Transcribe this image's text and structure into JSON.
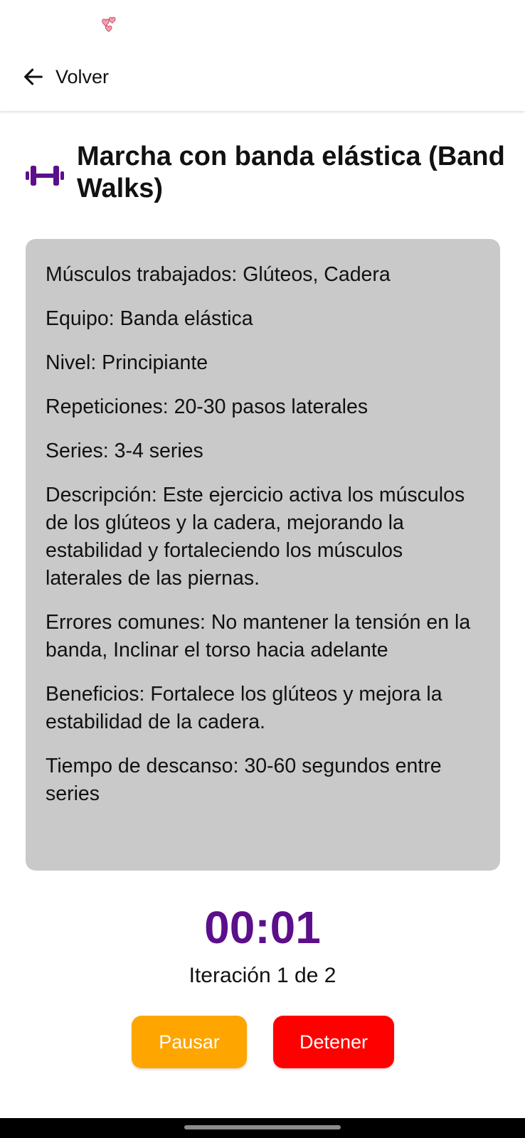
{
  "status_bar": {
    "icon": "hearts-icon"
  },
  "header": {
    "back_label": "Volver",
    "back_icon": "arrow-left-icon"
  },
  "exercise": {
    "icon": "dumbbell-icon",
    "title": "Marcha con banda elástica (Band Walks)",
    "details": [
      "Músculos trabajados: Glúteos, Cadera",
      "Equipo: Banda elástica",
      "Nivel: Principiante",
      "Repeticiones: 20-30 pasos laterales",
      "Series: 3-4 series",
      "Descripción: Este ejercicio activa los músculos de los glúteos y la cadera, mejorando la estabilidad y fortaleciendo los músculos laterales de las piernas.",
      "Errores comunes: No mantener la tensión en la banda, Inclinar el torso hacia adelante",
      "Beneficios: Fortalece los glúteos y mejora la estabilidad de la cadera.",
      "Tiempo de descanso: 30-60 segundos entre series"
    ]
  },
  "timer": {
    "display": "00:01",
    "iteration_text": "Iteración 1 de 2"
  },
  "buttons": {
    "pause_label": "Pausar",
    "stop_label": "Detener"
  },
  "colors": {
    "accent_purple": "#5c0f8b",
    "card_bg": "#c9c9c9",
    "pause_orange": "#ffa500",
    "stop_red": "#ff0000"
  }
}
